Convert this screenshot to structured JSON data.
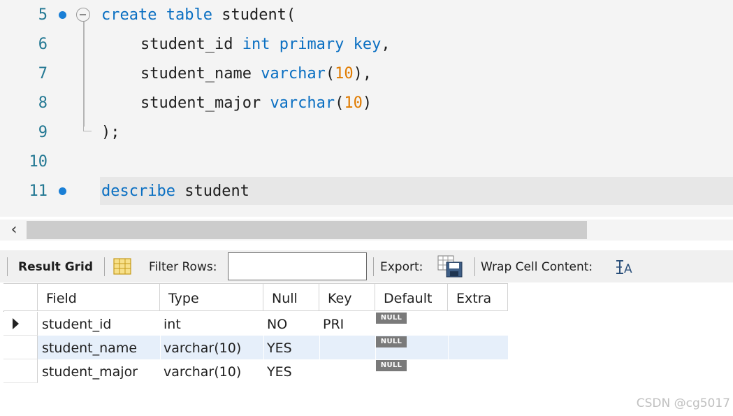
{
  "editor": {
    "lines": [
      {
        "num": "5",
        "breakpoint": true,
        "fold": true,
        "segments": [
          {
            "t": "create",
            "k": "kw"
          },
          {
            "t": " "
          },
          {
            "t": "table",
            "k": "kw"
          },
          {
            "t": " student("
          }
        ]
      },
      {
        "num": "6",
        "indent": true,
        "segments": [
          {
            "t": "student_id "
          },
          {
            "t": "int",
            "k": "kw"
          },
          {
            "t": " "
          },
          {
            "t": "primary",
            "k": "kw"
          },
          {
            "t": " "
          },
          {
            "t": "key",
            "k": "kw"
          },
          {
            "t": ","
          }
        ]
      },
      {
        "num": "7",
        "indent": true,
        "segments": [
          {
            "t": "student_name "
          },
          {
            "t": "varchar",
            "k": "kw"
          },
          {
            "t": "("
          },
          {
            "t": "10",
            "k": "num"
          },
          {
            "t": "),"
          }
        ]
      },
      {
        "num": "8",
        "indent": true,
        "segments": [
          {
            "t": "student_major "
          },
          {
            "t": "varchar",
            "k": "kw"
          },
          {
            "t": "("
          },
          {
            "t": "10",
            "k": "num"
          },
          {
            "t": ")"
          }
        ]
      },
      {
        "num": "9",
        "segments": [
          {
            "t": ");"
          }
        ]
      },
      {
        "num": "10",
        "segments": []
      },
      {
        "num": "11",
        "breakpoint": true,
        "current": true,
        "segments": [
          {
            "t": "describe",
            "k": "kw"
          },
          {
            "t": " student"
          }
        ]
      }
    ]
  },
  "toolbar": {
    "result_grid_label": "Result Grid",
    "filter_rows_label": "Filter Rows:",
    "filter_value": "",
    "export_label": "Export:",
    "wrap_label": "Wrap Cell Content:"
  },
  "grid": {
    "columns": [
      "Field",
      "Type",
      "Null",
      "Key",
      "Default",
      "Extra"
    ],
    "rows": [
      {
        "Field": "student_id",
        "Type": "int",
        "Null": "NO",
        "Key": "PRI",
        "Default": "NULL",
        "Extra": "",
        "selected": true
      },
      {
        "Field": "student_name",
        "Type": "varchar(10)",
        "Null": "YES",
        "Key": "",
        "Default": "NULL",
        "Extra": ""
      },
      {
        "Field": "student_major",
        "Type": "varchar(10)",
        "Null": "YES",
        "Key": "",
        "Default": "NULL",
        "Extra": ""
      }
    ]
  },
  "watermark": "CSDN @cg5017",
  "colors": {
    "keyword": "#0a6fc2",
    "number": "#e07b00",
    "line_number": "#237893",
    "selected_row": "#e6effa"
  }
}
